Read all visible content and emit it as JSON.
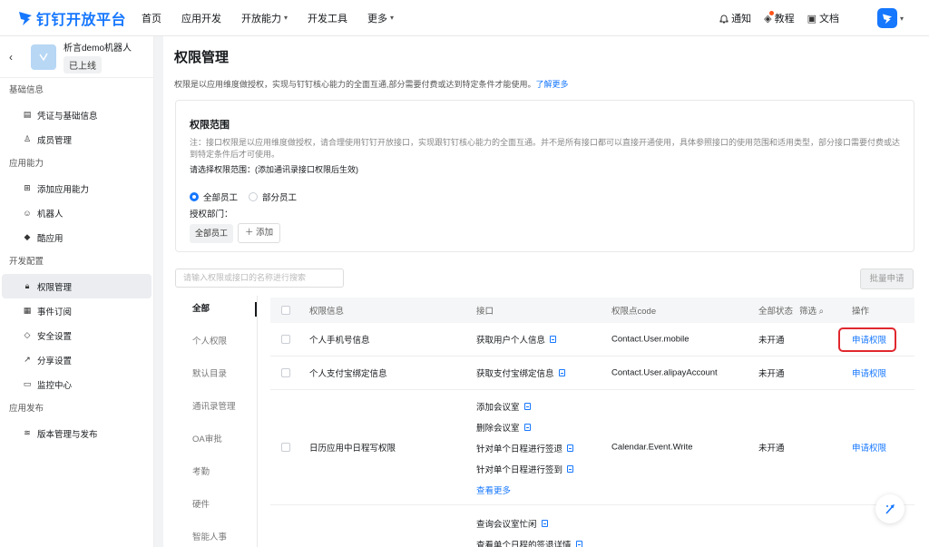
{
  "topnav": {
    "logo_text": "钉钉开放平台",
    "items": [
      {
        "label": "首页",
        "has_menu": false
      },
      {
        "label": "应用开发",
        "has_menu": false
      },
      {
        "label": "开放能力",
        "has_menu": true
      },
      {
        "label": "开发工具",
        "has_menu": false
      },
      {
        "label": "更多",
        "has_menu": true
      }
    ],
    "notify_label": "通知",
    "tutorial_label": "教程",
    "docs_label": "文档"
  },
  "sidebar": {
    "app_name": "析言demo机器人",
    "app_status": "已上线",
    "sections": [
      {
        "title": "基础信息",
        "items": [
          {
            "label": "凭证与基础信息",
            "icon": "credential-icon"
          },
          {
            "label": "成员管理",
            "icon": "member-icon"
          }
        ]
      },
      {
        "title": "应用能力",
        "items": [
          {
            "label": "添加应用能力",
            "icon": "grid-plus-icon"
          },
          {
            "label": "机器人",
            "icon": "robot-icon"
          },
          {
            "label": "酷应用",
            "icon": "cube-icon"
          }
        ]
      },
      {
        "title": "开发配置",
        "items": [
          {
            "label": "权限管理",
            "icon": "lock-icon",
            "active": true
          },
          {
            "label": "事件订阅",
            "icon": "event-icon"
          },
          {
            "label": "安全设置",
            "icon": "shield-icon"
          },
          {
            "label": "分享设置",
            "icon": "share-icon"
          },
          {
            "label": "监控中心",
            "icon": "monitor-icon"
          }
        ]
      },
      {
        "title": "应用发布",
        "items": [
          {
            "label": "版本管理与发布",
            "icon": "layers-icon"
          }
        ]
      }
    ]
  },
  "main": {
    "title": "权限管理",
    "desc": "权限是以应用维度做授权，实现与钉钉核心能力的全面互通,部分需要付费或达到特定条件才能使用。",
    "learn_more": "了解更多",
    "scope": {
      "title": "权限范围",
      "note": "注：接口权限是以应用维度做授权，请合理使用钉钉开放接口，实现跟钉钉核心能力的全面互通。并不是所有接口都可以直接开通使用，具体参照接口的使用范围和适用类型，部分接口需要付费或达到特定条件后才可使用。",
      "select_label": "请选择权限范围：(添加通讯录接口权限后生效)",
      "radio_all": "全部员工",
      "radio_partial": "部分员工",
      "dept_label": "授权部门：",
      "dept_tag": "全部员工",
      "add_label": "添加"
    },
    "search_placeholder": "请输入权限或接口的名称进行搜索",
    "batch_label": "批量申请",
    "categories": [
      "全部",
      "个人权限",
      "默认目录",
      "通讯录管理",
      "OA审批",
      "考勤",
      "硬件",
      "智能人事"
    ],
    "table": {
      "headers": {
        "name": "权限信息",
        "api": "接口",
        "code": "权限点code",
        "status": "全部状态",
        "filter": "筛选",
        "op": "操作"
      },
      "rows": [
        {
          "name": "个人手机号信息",
          "apis": [
            "获取用户个人信息"
          ],
          "code": "Contact.User.mobile",
          "status": "未开通",
          "op": "申请权限"
        },
        {
          "name": "个人支付宝绑定信息",
          "apis": [
            "获取支付宝绑定信息"
          ],
          "code": "Contact.User.alipayAccount",
          "status": "未开通",
          "op": "申请权限"
        },
        {
          "name": "日历应用中日程写权限",
          "apis": [
            "添加会议室",
            "删除会议室",
            "针对单个日程进行签退",
            "针对单个日程进行签到"
          ],
          "more": "查看更多",
          "code": "Calendar.Event.Write",
          "status": "未开通",
          "op": "申请权限"
        },
        {
          "name": "",
          "apis": [
            "查询会议室忙闲",
            "查看单个日程的签退详情"
          ],
          "code": "",
          "status": "",
          "op": ""
        }
      ]
    }
  }
}
